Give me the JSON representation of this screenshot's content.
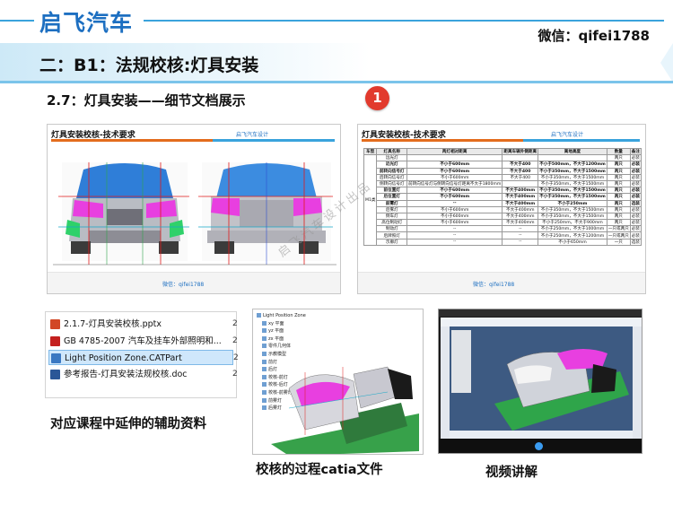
{
  "header": {
    "brand": "启飞汽车",
    "wechat": "微信：qifei1788",
    "section_title": "二：B1：法规校核:灯具安装",
    "subheading": "2.7：灯具安装——细节文档展示",
    "badge": "1"
  },
  "slide_left": {
    "title": "灯具安装校核-技术要求",
    "brand_tag": "启飞汽车设计",
    "footer": "微信：qifei1788"
  },
  "slide_right": {
    "title": "灯具安装校核-技术要求",
    "brand_tag": "启飞汽车设计",
    "footer": "微信：qifei1788",
    "watermark": "启飞汽车设计出品",
    "table": {
      "headers": [
        "车型",
        "灯具名称",
        "两灯相对距离",
        "距离车辆外侧距离",
        "离地高度",
        "数量",
        "备注"
      ],
      "group_label": "M1类",
      "rows": [
        {
          "lamp": "远光灯",
          "c1": "",
          "c2": "",
          "c3": "",
          "qty": "两只",
          "note": "必装",
          "bold": false
        },
        {
          "lamp": "近光灯",
          "c1": "不小于600mm",
          "c2": "不大于400",
          "c3": "不小于500mm，不大于1200mm",
          "qty": "两只",
          "note": "必装",
          "bold": true
        },
        {
          "lamp": "前转向信号灯",
          "c1": "不小于600mm",
          "c2": "不大于400",
          "c3": "不小于350mm，不大于1500mm",
          "qty": "两只",
          "note": "必装",
          "bold": true
        },
        {
          "lamp": "后转向信号灯",
          "c1": "不小于600mm",
          "c2": "不大于400",
          "c3": "不小于350mm，不大于1500mm",
          "qty": "两只",
          "note": "必装",
          "bold": false
        },
        {
          "lamp": "侧转向信号灯",
          "c1": "前转向信号灯与侧转向信号灯距离不大于1800mm",
          "c2": "",
          "c3": "不小于350mm，不大于1500mm",
          "qty": "两只",
          "note": "必装",
          "bold": false
        },
        {
          "lamp": "前位置灯",
          "c1": "不小于600mm",
          "c2": "不大于400mm",
          "c3": "不小于350mm，不大于1500mm",
          "qty": "两只",
          "note": "必装",
          "bold": true
        },
        {
          "lamp": "后位置灯",
          "c1": "不小于600mm",
          "c2": "不大于400mm",
          "c3": "不小于350mm，不大于1500mm",
          "qty": "两只",
          "note": "必装",
          "bold": true
        },
        {
          "lamp": "前雾灯",
          "c1": "--",
          "c2": "不大于400mm",
          "c3": "不小于250mm",
          "qty": "两只",
          "note": "选装",
          "bold": true
        },
        {
          "lamp": "后雾灯",
          "c1": "不小于600mm",
          "c2": "不大于400mm",
          "c3": "不小于350mm，不大于1500mm",
          "qty": "两只",
          "note": "必装",
          "bold": false
        },
        {
          "lamp": "倒车灯",
          "c1": "不小于600mm",
          "c2": "不大于400mm",
          "c3": "不小于350mm，不大于1500mm",
          "qty": "两只",
          "note": "必装",
          "bold": false
        },
        {
          "lamp": "高位制动灯",
          "c1": "不小于600mm",
          "c2": "不大于400mm",
          "c3": "不小于250mm，不大于900mm",
          "qty": "两只",
          "note": "必装",
          "bold": false
        },
        {
          "lamp": "制动灯",
          "c1": "--",
          "c2": "--",
          "c3": "不小于250mm，不大于1000mm",
          "qty": "一只或两只",
          "note": "必装",
          "bold": false
        },
        {
          "lamp": "后牌照灯",
          "c1": "--",
          "c2": "--",
          "c3": "不小于250mm，不大于1200mm",
          "qty": "一只或两只",
          "note": "必装",
          "bold": false
        },
        {
          "lamp": "示廓灯",
          "c1": "--",
          "c2": "--",
          "c3": "不小于650mm",
          "qty": "一只",
          "note": "选装",
          "bold": false
        }
      ]
    }
  },
  "files": [
    {
      "name": "2.1.7-灯具安装校核.pptx",
      "num": "2",
      "icon": "pptx-icon",
      "color": "#d24726",
      "selected": false
    },
    {
      "name": "GB 4785-2007 汽车及挂车外部照明和...",
      "num": "2",
      "icon": "pdf-icon",
      "color": "#c4201f",
      "selected": false
    },
    {
      "name": "Light Position Zone.CATPart",
      "num": "2",
      "icon": "catpart-icon",
      "color": "#3a78c2",
      "selected": true
    },
    {
      "name": "参考报告-灯具安装法规校核.doc",
      "num": "2",
      "icon": "doc-icon",
      "color": "#2b5797",
      "selected": false
    }
  ],
  "captions": {
    "files": "对应课程中延伸的辅助资料",
    "catia": "校核的过程catia文件",
    "video": "视频讲解"
  },
  "catia": {
    "tree": [
      "Light Position Zone",
      "xy 平面",
      "yz 平面",
      "zx 平面",
      "零件几何体",
      "示教模型",
      "前灯",
      "后灯",
      "校核-前灯",
      "校核-后灯",
      "校核-前雾灯区",
      "前雾灯",
      "后雾灯"
    ]
  },
  "colors": {
    "brand_blue": "#1d6fc1",
    "badge_red": "#e23a2d",
    "accent_orange": "#e36c1d"
  }
}
